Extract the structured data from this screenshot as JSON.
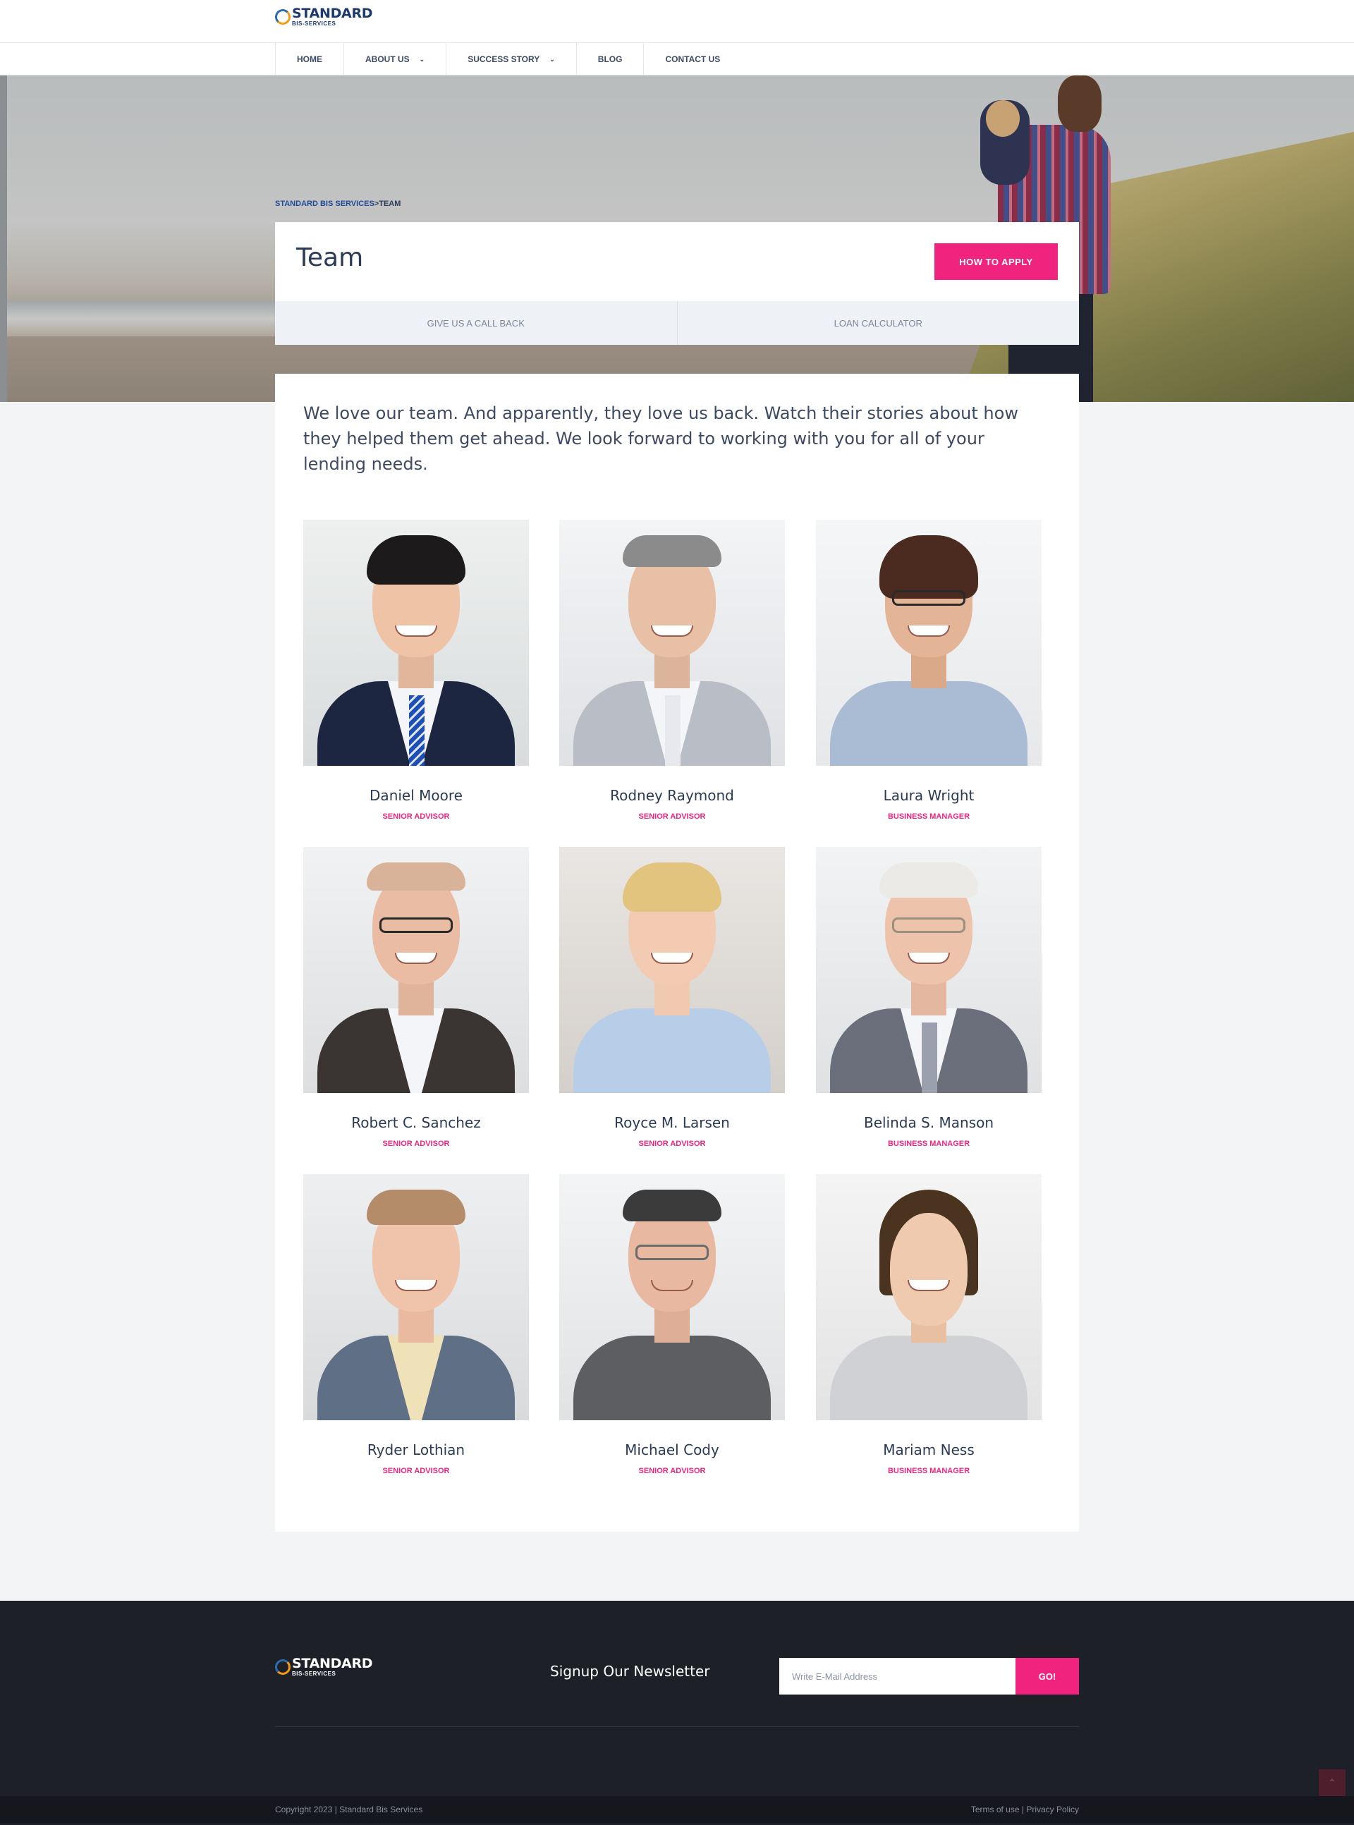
{
  "brand": {
    "name": "STANDARD",
    "tagline": "BIS-SERVICES"
  },
  "nav": {
    "items": [
      {
        "label": "HOME"
      },
      {
        "label": "ABOUT US"
      },
      {
        "label": "SUCCESS STORY"
      },
      {
        "label": "BLOG"
      },
      {
        "label": "CONTACT US"
      }
    ]
  },
  "breadcrumb": {
    "home": "STANDARD BIS SERVICES",
    "separator": ">",
    "current": "TEAM"
  },
  "page": {
    "title": "Team",
    "apply_label": "HOW TO APPLY",
    "actions": [
      "GIVE US A CALL BACK",
      "LOAN CALCULATOR"
    ],
    "intro": "We love our team. And apparently, they love us back. Watch their stories about how they helped them get ahead. We look forward to working with you for all of your lending needs."
  },
  "team": [
    {
      "name": "Daniel Moore",
      "role": "SENIOR ADVISOR"
    },
    {
      "name": "Rodney Raymond",
      "role": "SENIOR ADVISOR"
    },
    {
      "name": "Laura Wright",
      "role": "BUSINESS MANAGER"
    },
    {
      "name": "Robert C. Sanchez",
      "role": "SENIOR ADVISOR"
    },
    {
      "name": "Royce M. Larsen",
      "role": "SENIOR ADVISOR"
    },
    {
      "name": "Belinda S. Manson",
      "role": "BUSINESS MANAGER"
    },
    {
      "name": "Ryder Lothian",
      "role": "SENIOR ADVISOR"
    },
    {
      "name": "Michael Cody",
      "role": "SENIOR ADVISOR"
    },
    {
      "name": "Mariam Ness",
      "role": "BUSINESS MANAGER"
    }
  ],
  "footer": {
    "newsletter_title": "Signup Our Newsletter",
    "email_placeholder": "Write E-Mail Address",
    "submit_label": "GO!",
    "copyright": "Copyright 2023 | Standard Bis Services",
    "terms": "Terms of use",
    "legal_sep": " | ",
    "privacy": "Privacy Policy"
  },
  "colors": {
    "accent": "#f0237f",
    "navy": "#1d3a6e",
    "footer_bg": "#1e2028"
  }
}
